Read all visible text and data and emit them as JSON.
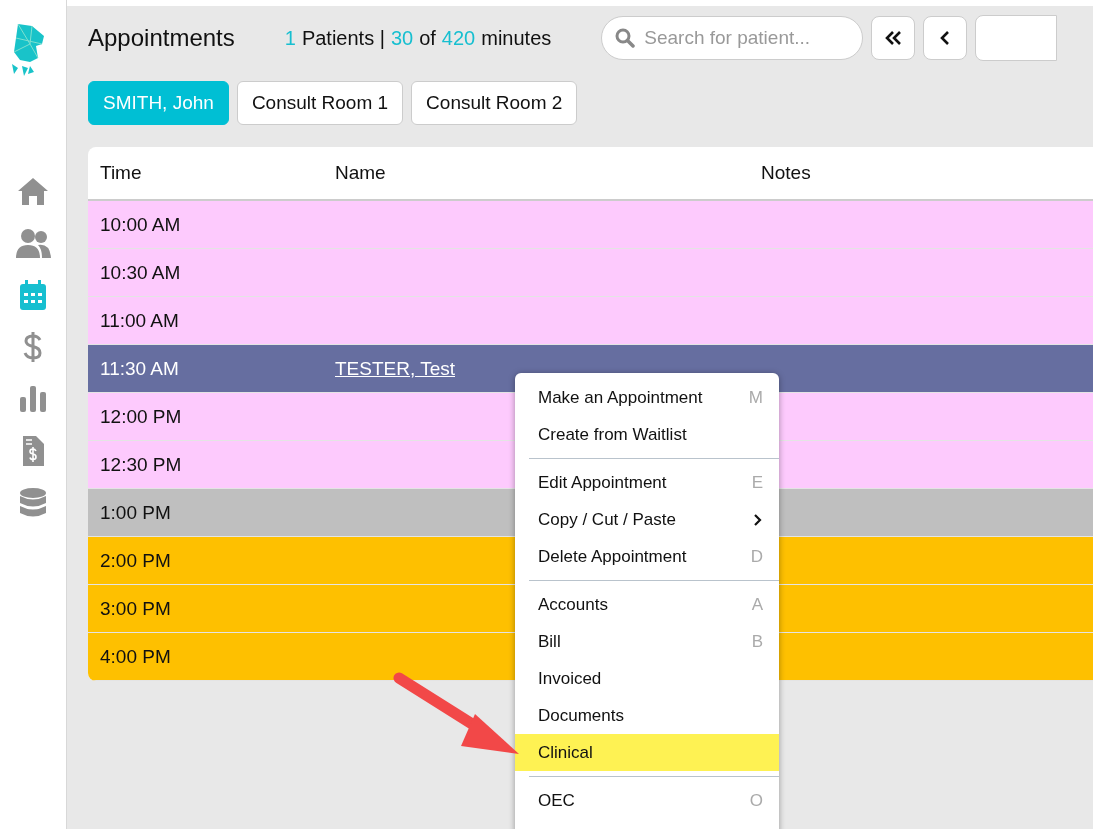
{
  "sidebar": {
    "items": [
      {
        "selected": false
      },
      {
        "selected": false
      },
      {
        "selected": true
      },
      {
        "selected": false
      },
      {
        "selected": false
      },
      {
        "selected": false
      },
      {
        "selected": false
      }
    ]
  },
  "header": {
    "title": "Appointments",
    "stats": [
      {
        "text": "1",
        "highlight": true
      },
      {
        "text": "Patients |",
        "highlight": false
      },
      {
        "text": "30",
        "highlight": true
      },
      {
        "text": "of",
        "highlight": false
      },
      {
        "text": "420",
        "highlight": true
      },
      {
        "text": "minutes",
        "highlight": false
      }
    ],
    "search": {
      "placeholder": "Search for patient..."
    }
  },
  "tabs": [
    {
      "label": "SMITH, John",
      "selected": true
    },
    {
      "label": "Consult Room 1",
      "selected": false
    },
    {
      "label": "Consult Room 2",
      "selected": false
    }
  ],
  "table": {
    "columns": [
      "Time",
      "Name",
      "Notes"
    ],
    "rows": [
      {
        "time": "10:00 AM",
        "color": "#fdcafd",
        "selected": false
      },
      {
        "time": "10:30 AM",
        "color": "#fdcafd",
        "selected": false
      },
      {
        "time": "11:00 AM",
        "color": "#fdcafd",
        "selected": false
      },
      {
        "time": "11:30 AM",
        "name": "TESTER, Test",
        "color": "#666ea0",
        "selected": true
      },
      {
        "time": "12:00 PM",
        "color": "#fdcafd",
        "selected": false
      },
      {
        "time": "12:30 PM",
        "color": "#fdcafd",
        "selected": false
      },
      {
        "time": "1:00 PM",
        "color": "#bfbfbf",
        "selected": false
      },
      {
        "time": "2:00 PM",
        "color": "#fec000",
        "selected": false
      },
      {
        "time": "3:00 PM",
        "color": "#fec000",
        "selected": false
      },
      {
        "time": "4:00 PM",
        "color": "#fec000",
        "selected": false
      }
    ]
  },
  "context_menu": {
    "groups": [
      [
        {
          "label": "Make an Appointment",
          "shortcut": "M",
          "selected": false
        },
        {
          "label": "Create from Waitlist",
          "selected": false
        }
      ],
      [
        {
          "label": "Edit Appointment",
          "shortcut": "E",
          "selected": false
        },
        {
          "label": "Copy / Cut / Paste",
          "submenu": true,
          "selected": false
        },
        {
          "label": "Delete Appointment",
          "shortcut": "D",
          "selected": false
        }
      ],
      [
        {
          "label": "Accounts",
          "shortcut": "A",
          "selected": false
        },
        {
          "label": "Bill",
          "shortcut": "B",
          "selected": false
        },
        {
          "label": "Invoiced",
          "selected": false
        },
        {
          "label": "Documents",
          "selected": false
        },
        {
          "label": "Clinical",
          "selected": true
        }
      ],
      [
        {
          "label": "OEC",
          "shortcut": "O",
          "selected": false
        }
      ]
    ]
  }
}
